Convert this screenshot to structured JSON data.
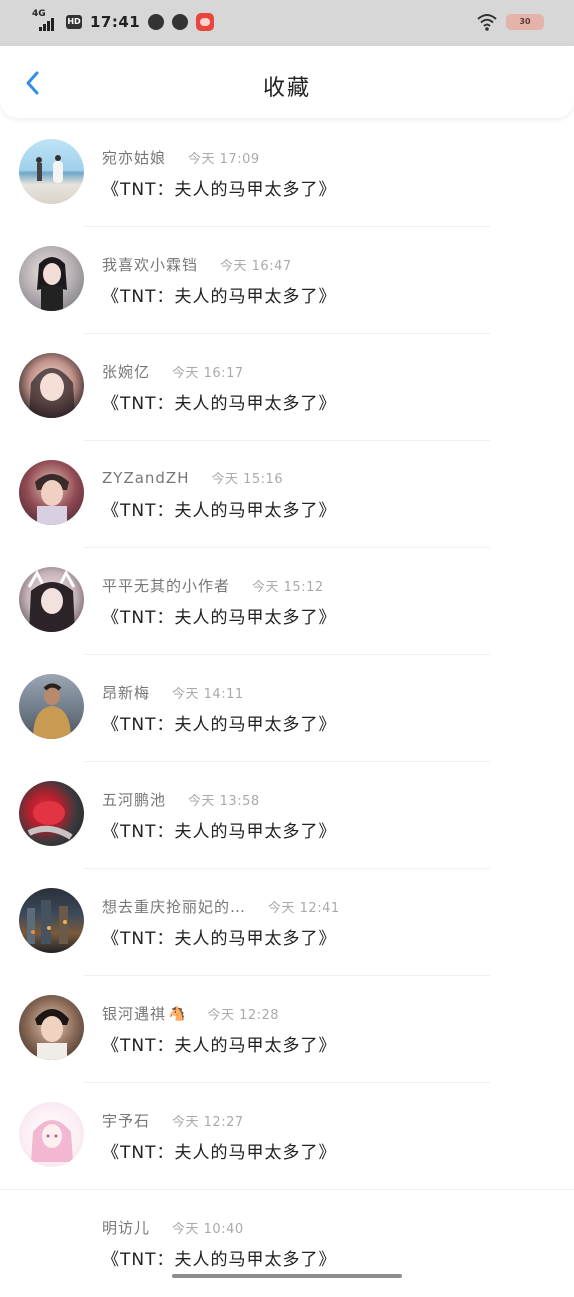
{
  "status_bar": {
    "network": "4G",
    "hd": "HD",
    "time": "17:41",
    "battery": "30"
  },
  "header": {
    "title": "收藏",
    "back_icon": "chevron-left-icon",
    "accent": "#2f8ee8"
  },
  "items": [
    {
      "name": "宛亦姑娘",
      "time": "今天 17:09",
      "book": "《TNT：夫人的马甲太多了》"
    },
    {
      "name": "我喜欢小霖铛",
      "time": "今天 16:47",
      "book": "《TNT：夫人的马甲太多了》"
    },
    {
      "name": "张婉亿",
      "time": "今天 16:17",
      "book": "《TNT：夫人的马甲太多了》"
    },
    {
      "name": "ZYZandZH",
      "time": "今天 15:16",
      "book": "《TNT：夫人的马甲太多了》"
    },
    {
      "name": "平平无其的小作者",
      "time": "今天 15:12",
      "book": "《TNT：夫人的马甲太多了》"
    },
    {
      "name": "昂新梅",
      "time": "今天 14:11",
      "book": "《TNT：夫人的马甲太多了》"
    },
    {
      "name": "五河鹏池",
      "time": "今天 13:58",
      "book": "《TNT：夫人的马甲太多了》"
    },
    {
      "name": "想去重庆抢丽妃的…",
      "time": "今天 12:41",
      "book": "《TNT：夫人的马甲太多了》"
    },
    {
      "name": "银河遇祺",
      "time": "今天 12:28",
      "book": "《TNT：夫人的马甲太多了》"
    },
    {
      "name": "宇予石",
      "time": "今天 12:27",
      "book": "《TNT：夫人的马甲太多了》"
    },
    {
      "name": "明访儿",
      "time": "今天 10:40",
      "book": "《TNT：夫人的马甲太多了》"
    }
  ]
}
